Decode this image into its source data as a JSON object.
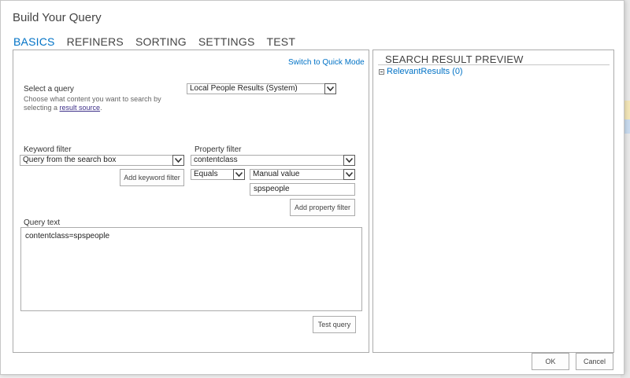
{
  "dialog": {
    "title": "Build Your Query"
  },
  "tabs": [
    {
      "label": "BASICS"
    },
    {
      "label": "REFINERS"
    },
    {
      "label": "SORTING"
    },
    {
      "label": "SETTINGS"
    },
    {
      "label": "TEST"
    }
  ],
  "left": {
    "switch_link": "Switch to Quick Mode",
    "select_query": {
      "label": "Select a query",
      "desc_line1": "Choose what content you want to search by",
      "desc_prefix": "selecting a ",
      "desc_link": "result source",
      "desc_suffix": ".",
      "value": "Local People Results (System)"
    },
    "keyword_filter": {
      "label": "Keyword filter",
      "value": "Query from the search box",
      "button": "Add keyword filter"
    },
    "property_filter": {
      "label": "Property filter",
      "property": "contentclass",
      "operator": "Equals",
      "value_type": "Manual value",
      "value": "spspeople",
      "button": "Add property filter"
    },
    "query_text": {
      "label": "Query text",
      "value": "contentclass=spspeople"
    },
    "test_button": "Test query"
  },
  "right": {
    "title": "SEARCH RESULT PREVIEW",
    "tree_item": "RelevantResults (0)"
  },
  "footer": {
    "ok": "OK",
    "cancel": "Cancel"
  }
}
